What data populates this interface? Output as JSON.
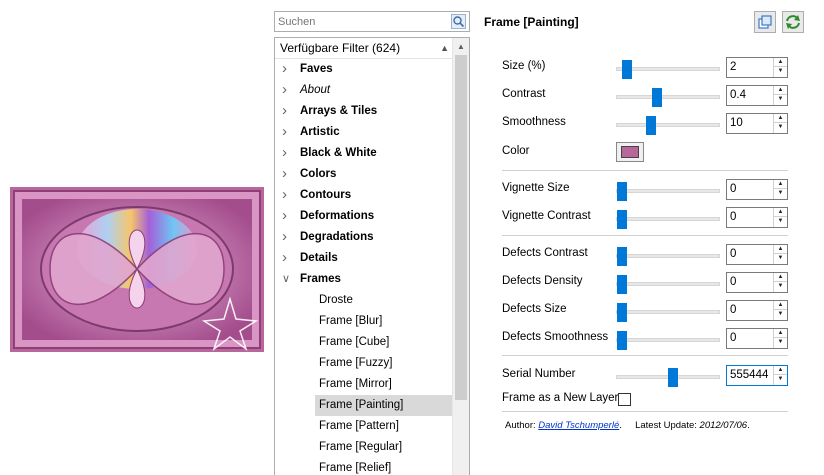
{
  "search": {
    "placeholder": "Suchen",
    "value": ""
  },
  "filter_tree": {
    "header": "Verfügbare Filter (624)",
    "categories": [
      {
        "label": "Faves",
        "italic": false
      },
      {
        "label": "About",
        "italic": true
      },
      {
        "label": "Arrays & Tiles",
        "italic": false
      },
      {
        "label": "Artistic",
        "italic": false
      },
      {
        "label": "Black & White",
        "italic": false
      },
      {
        "label": "Colors",
        "italic": false
      },
      {
        "label": "Contours",
        "italic": false
      },
      {
        "label": "Deformations",
        "italic": false
      },
      {
        "label": "Degradations",
        "italic": false
      },
      {
        "label": "Details",
        "italic": false
      },
      {
        "label": "Frames",
        "italic": false,
        "expanded": true
      }
    ],
    "frames_children": [
      "Droste",
      "Frame [Blur]",
      "Frame [Cube]",
      "Frame [Fuzzy]",
      "Frame [Mirror]",
      "Frame [Painting]",
      "Frame [Pattern]",
      "Frame [Regular]",
      "Frame [Relief]"
    ],
    "selected": "Frame [Painting]"
  },
  "panel": {
    "title": "Frame [Painting]",
    "params": {
      "size": {
        "label": "Size (%)",
        "value": "2",
        "level": 0.05
      },
      "contrast": {
        "label": "Contrast",
        "value": "0.4",
        "level": 0.38
      },
      "smoothness": {
        "label": "Smoothness",
        "value": "10",
        "level": 0.32
      },
      "color": {
        "label": "Color",
        "value": "#b8679b"
      },
      "vignette_size": {
        "label": "Vignette Size",
        "value": "0",
        "level": 0.0
      },
      "vignette_contrast": {
        "label": "Vignette Contrast",
        "value": "0",
        "level": 0.0
      },
      "defects_contrast": {
        "label": "Defects Contrast",
        "value": "0",
        "level": 0.0
      },
      "defects_density": {
        "label": "Defects Density",
        "value": "0",
        "level": 0.0
      },
      "defects_size": {
        "label": "Defects Size",
        "value": "0",
        "level": 0.0
      },
      "defects_smoothness": {
        "label": "Defects Smoothness",
        "value": "0",
        "level": 0.0
      },
      "serial_number": {
        "label": "Serial Number",
        "value": "555444",
        "level": 0.55
      },
      "new_layer": {
        "label": "Frame as a New Layer",
        "checked": false
      }
    },
    "footer": {
      "author_label": "Author:",
      "author_name": "David Tschumperlé",
      "author_suffix": ".",
      "update_label": "Latest Update:",
      "update_date": "2012/07/06",
      "update_suffix": "."
    }
  },
  "icons": {
    "search": "search-icon",
    "copy": "copy-layer-icon",
    "refresh": "refresh-icon",
    "expand": "chevron-right-icon",
    "collapse": "chevron-down-icon"
  },
  "colors": {
    "accent": "#0078d7",
    "selection": "#d9d9d9",
    "frame_pink": "#b8679b"
  }
}
